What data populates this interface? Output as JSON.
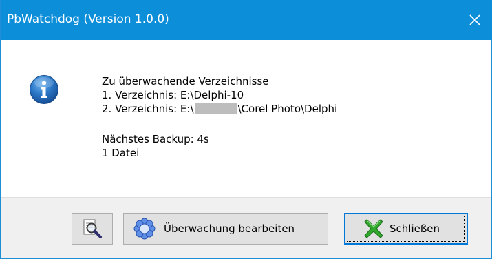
{
  "window": {
    "title": "PbWatchdog (Version 1.0.0)",
    "close_glyph": "✕",
    "titlebar_color": "#0d8ed9"
  },
  "message": {
    "icon": "info-icon",
    "heading": "Zu überwachende Verzeichnisse",
    "dir1": "1. Verzeichnis: E:\\Delphi-10",
    "dir2_prefix": "2. Verzeichnis: E:\\",
    "dir2_suffix": "\\Corel Photo\\Delphi",
    "next_backup": "Nächstes Backup: 4s",
    "file_count": "1 Datei"
  },
  "buttons": {
    "search": {
      "icon": "magnifier-document-icon"
    },
    "edit": {
      "icon": "gear-flower-icon",
      "label": "Überwachung bearbeiten"
    },
    "close": {
      "icon": "green-x-icon",
      "label": "Schließen",
      "focus_color": "#0078d7"
    }
  }
}
